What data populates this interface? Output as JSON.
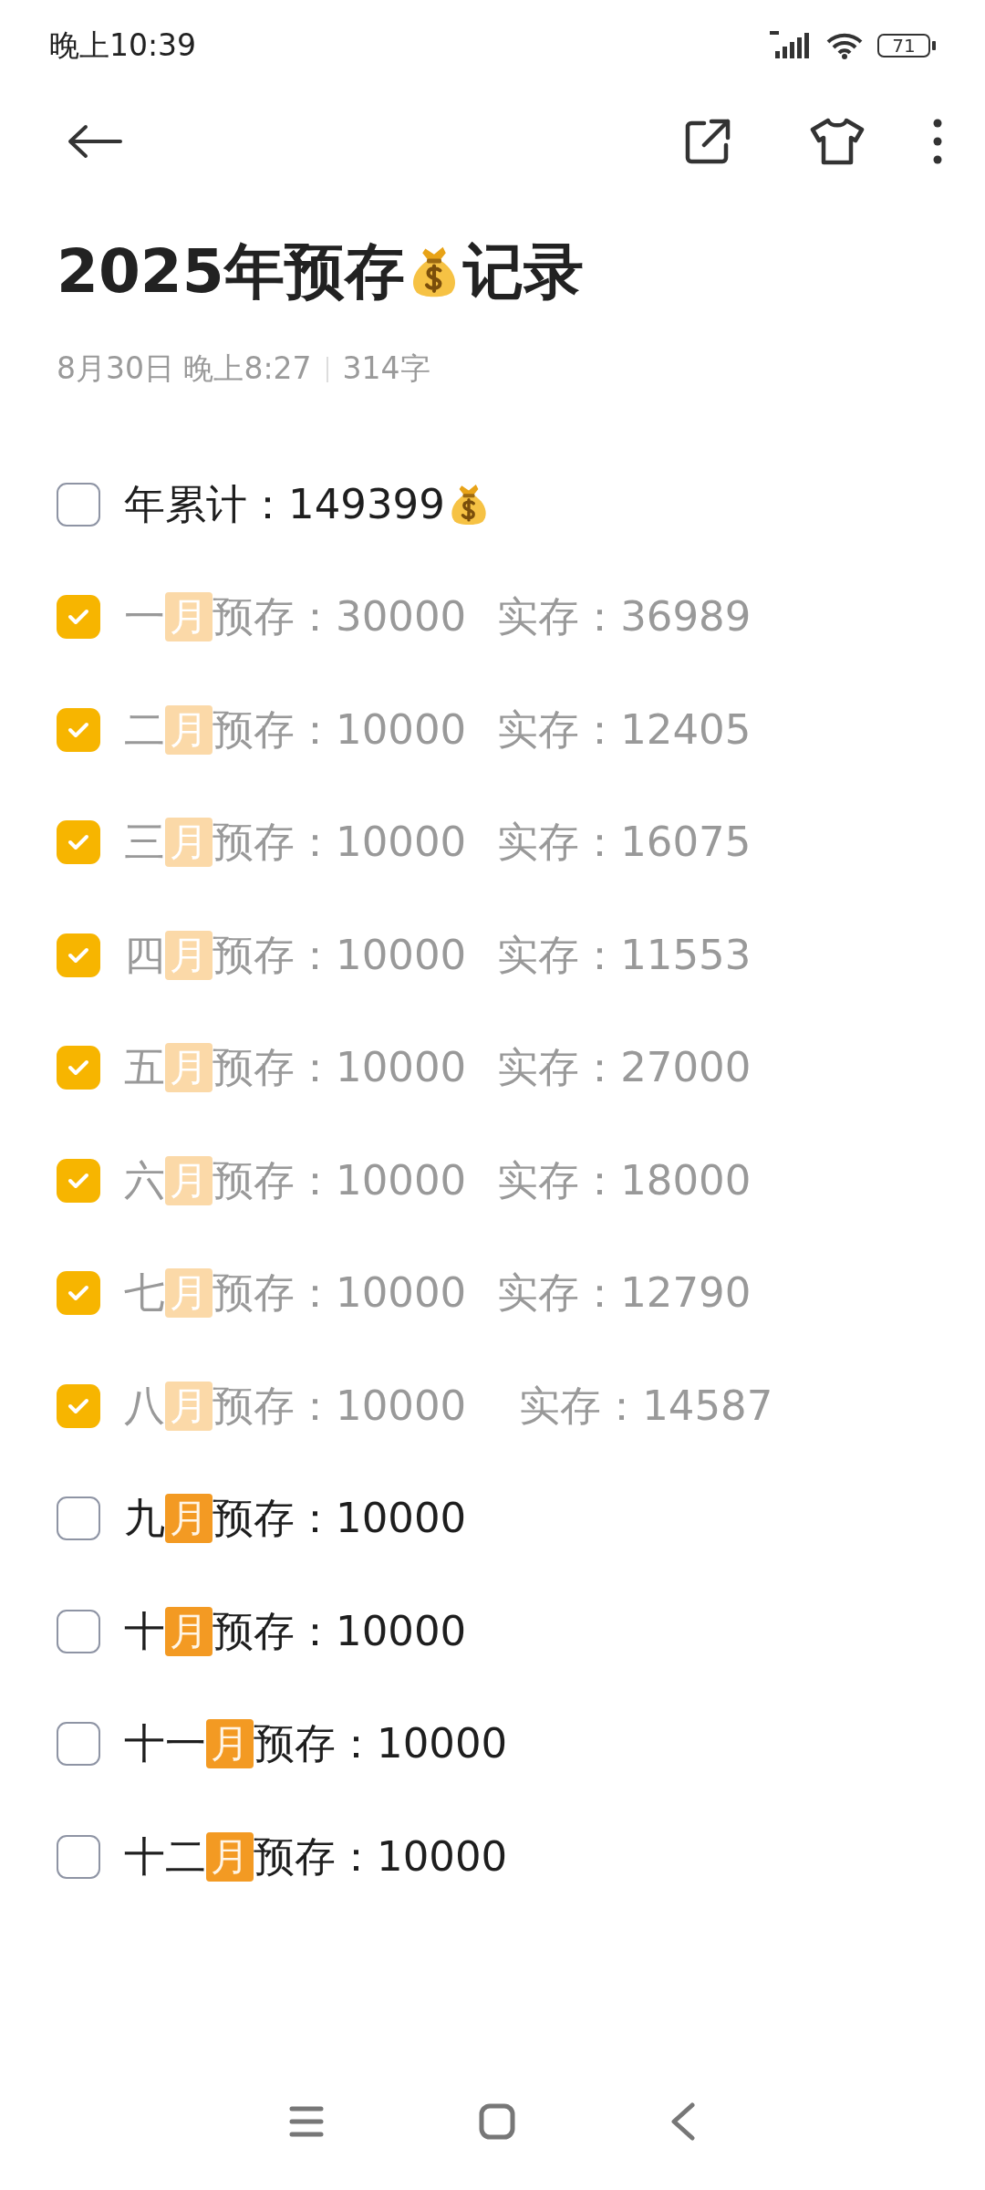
{
  "status_bar": {
    "time": "晚上10:39",
    "battery": "71"
  },
  "note": {
    "title_before": "2025年预存",
    "title_after": "记录",
    "date": "8月30日 晚上8:27",
    "word_count": "314字"
  },
  "items": [
    {
      "kind": "total",
      "checked": false,
      "text": "年累计：149399"
    },
    {
      "kind": "month",
      "checked": true,
      "prefix": "一",
      "month": "月",
      "planned": "预存：30000",
      "actual": "实存：36989"
    },
    {
      "kind": "month",
      "checked": true,
      "prefix": "二",
      "month": "月",
      "planned": "预存：10000",
      "actual": "实存：12405"
    },
    {
      "kind": "month",
      "checked": true,
      "prefix": "三",
      "month": "月",
      "planned": "预存：10000",
      "actual": "实存：16075"
    },
    {
      "kind": "month",
      "checked": true,
      "prefix": "四",
      "month": "月",
      "planned": "预存：10000",
      "actual": "实存：11553"
    },
    {
      "kind": "month",
      "checked": true,
      "prefix": "五",
      "month": "月",
      "planned": "预存：10000",
      "actual": "实存：27000"
    },
    {
      "kind": "month",
      "checked": true,
      "prefix": "六",
      "month": "月",
      "planned": "预存：10000",
      "actual": "实存：18000"
    },
    {
      "kind": "month",
      "checked": true,
      "prefix": "七",
      "month": "月",
      "planned": "预存：10000",
      "actual": "实存：12790"
    },
    {
      "kind": "month",
      "checked": true,
      "prefix": "八",
      "month": "月",
      "planned": "预存：10000",
      "actual": "实存：14587"
    },
    {
      "kind": "month",
      "checked": false,
      "prefix": "九",
      "month": "月",
      "planned": "预存：10000"
    },
    {
      "kind": "month",
      "checked": false,
      "prefix": "十",
      "month": "月",
      "planned": "预存：10000"
    },
    {
      "kind": "month",
      "checked": false,
      "prefix": "十一",
      "month": "月",
      "planned": "预存：10000"
    },
    {
      "kind": "month",
      "checked": false,
      "prefix": "十二",
      "month": "月",
      "planned": "预存：10000"
    }
  ]
}
